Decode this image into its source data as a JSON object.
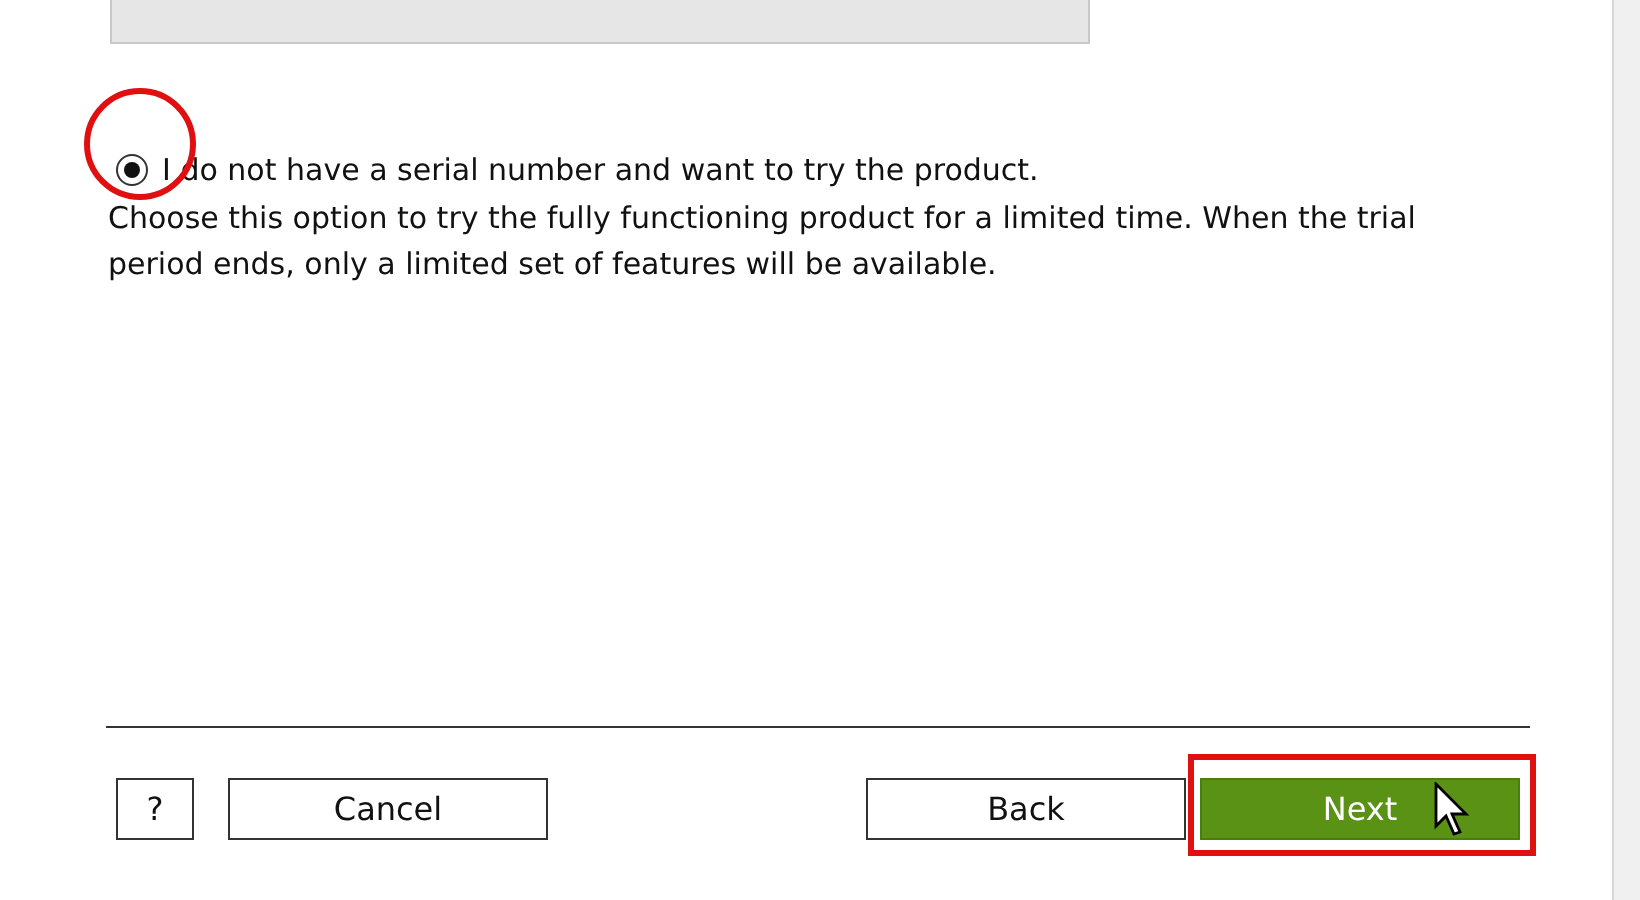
{
  "options": [
    {
      "label": "I do not have a serial number and want to try the product.",
      "selected": true,
      "description": "Choose this option to try the fully functioning product for a limited time. When the trial period ends, only a limited set of features will be available."
    }
  ],
  "buttons": [
    {
      "kind": "help",
      "label": "?",
      "primary": false
    },
    {
      "kind": "cancel",
      "label": "Cancel",
      "primary": false
    },
    {
      "kind": "back",
      "label": "Back",
      "primary": false
    },
    {
      "kind": "next",
      "label": "Next",
      "primary": true
    }
  ]
}
